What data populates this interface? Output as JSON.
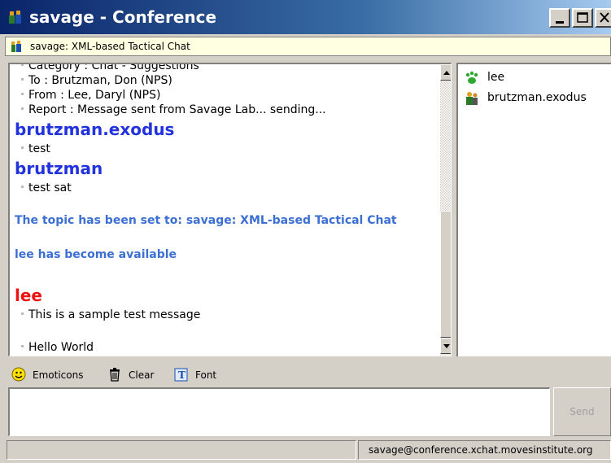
{
  "window": {
    "title": "savage - Conference",
    "icon": "conference-people-icon"
  },
  "topic_bar": {
    "text": "savage: XML-based Tactical Chat",
    "icon": "conference-people-icon"
  },
  "chat": {
    "report_lines": [
      "Category : Chat - Suggestions",
      "To : Brutzman, Don (NPS)",
      "From : Lee, Daryl (NPS)",
      "Report : Message sent from Savage Lab... sending..."
    ],
    "messages": [
      {
        "sender": "brutzman.exodus",
        "text": "test"
      },
      {
        "sender": "brutzman",
        "text": "test sat"
      }
    ],
    "system_1": "The topic has been set to: savage: XML-based Tactical Chat",
    "system_2": "lee has become available",
    "lee_sender": "lee",
    "lee_messages": [
      "This is a sample test message",
      "Hello World"
    ],
    "colors": {
      "sender_blue": "#2233dd",
      "sender_red": "#ee1111",
      "system": "#3b6fd4"
    }
  },
  "roster": {
    "items": [
      {
        "name": "lee",
        "icon": "paw-available-icon"
      },
      {
        "name": "brutzman.exodus",
        "icon": "person-icon"
      }
    ]
  },
  "toolbar": {
    "emoticons": "Emoticons",
    "clear": "Clear",
    "font": "Font"
  },
  "input": {
    "value": ""
  },
  "send_label": "Send",
  "status": {
    "left": "",
    "right": "savage@conference.xchat.movesinstitute.org"
  }
}
